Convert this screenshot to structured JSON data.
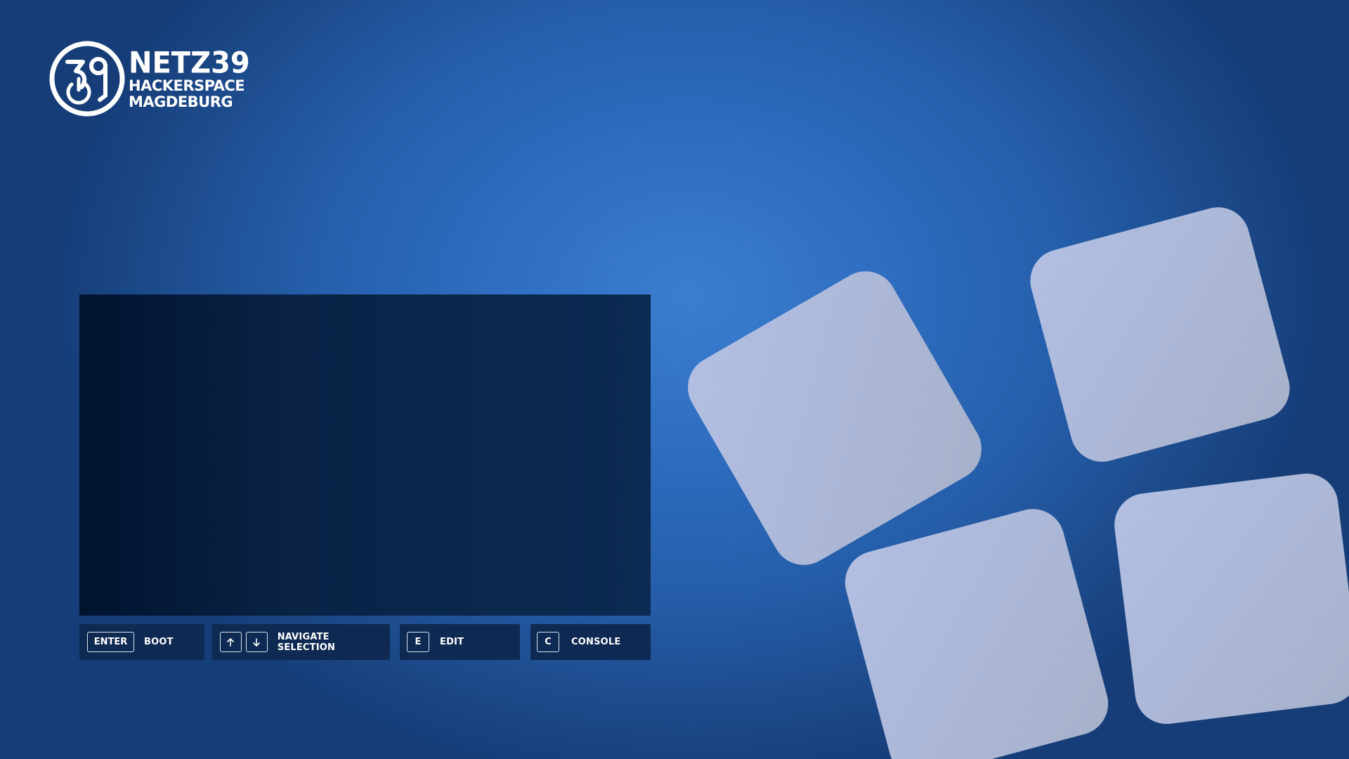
{
  "brand": {
    "title": "NETZ39",
    "subtitle_line1": "HACKERSPACE",
    "subtitle_line2": "MAGDEBURG",
    "logo_numeral": "39",
    "logo_icon": "power-icon"
  },
  "colors": {
    "background": "#2d6bbd",
    "panel": "#0d2a52",
    "hint_bg": "#0f2a52",
    "tile": "#aab8d8",
    "text": "#ffffff"
  },
  "boot_menu": {
    "entries": []
  },
  "hints": {
    "boot": {
      "key": "ENTER",
      "label": "BOOT"
    },
    "navigate": {
      "key_up": "up-arrow-icon",
      "key_down": "down-arrow-icon",
      "label": "NAVIGATE SELECTION"
    },
    "edit": {
      "key": "E",
      "label": "EDIT"
    },
    "console": {
      "key": "C",
      "label": "CONSOLE"
    }
  }
}
